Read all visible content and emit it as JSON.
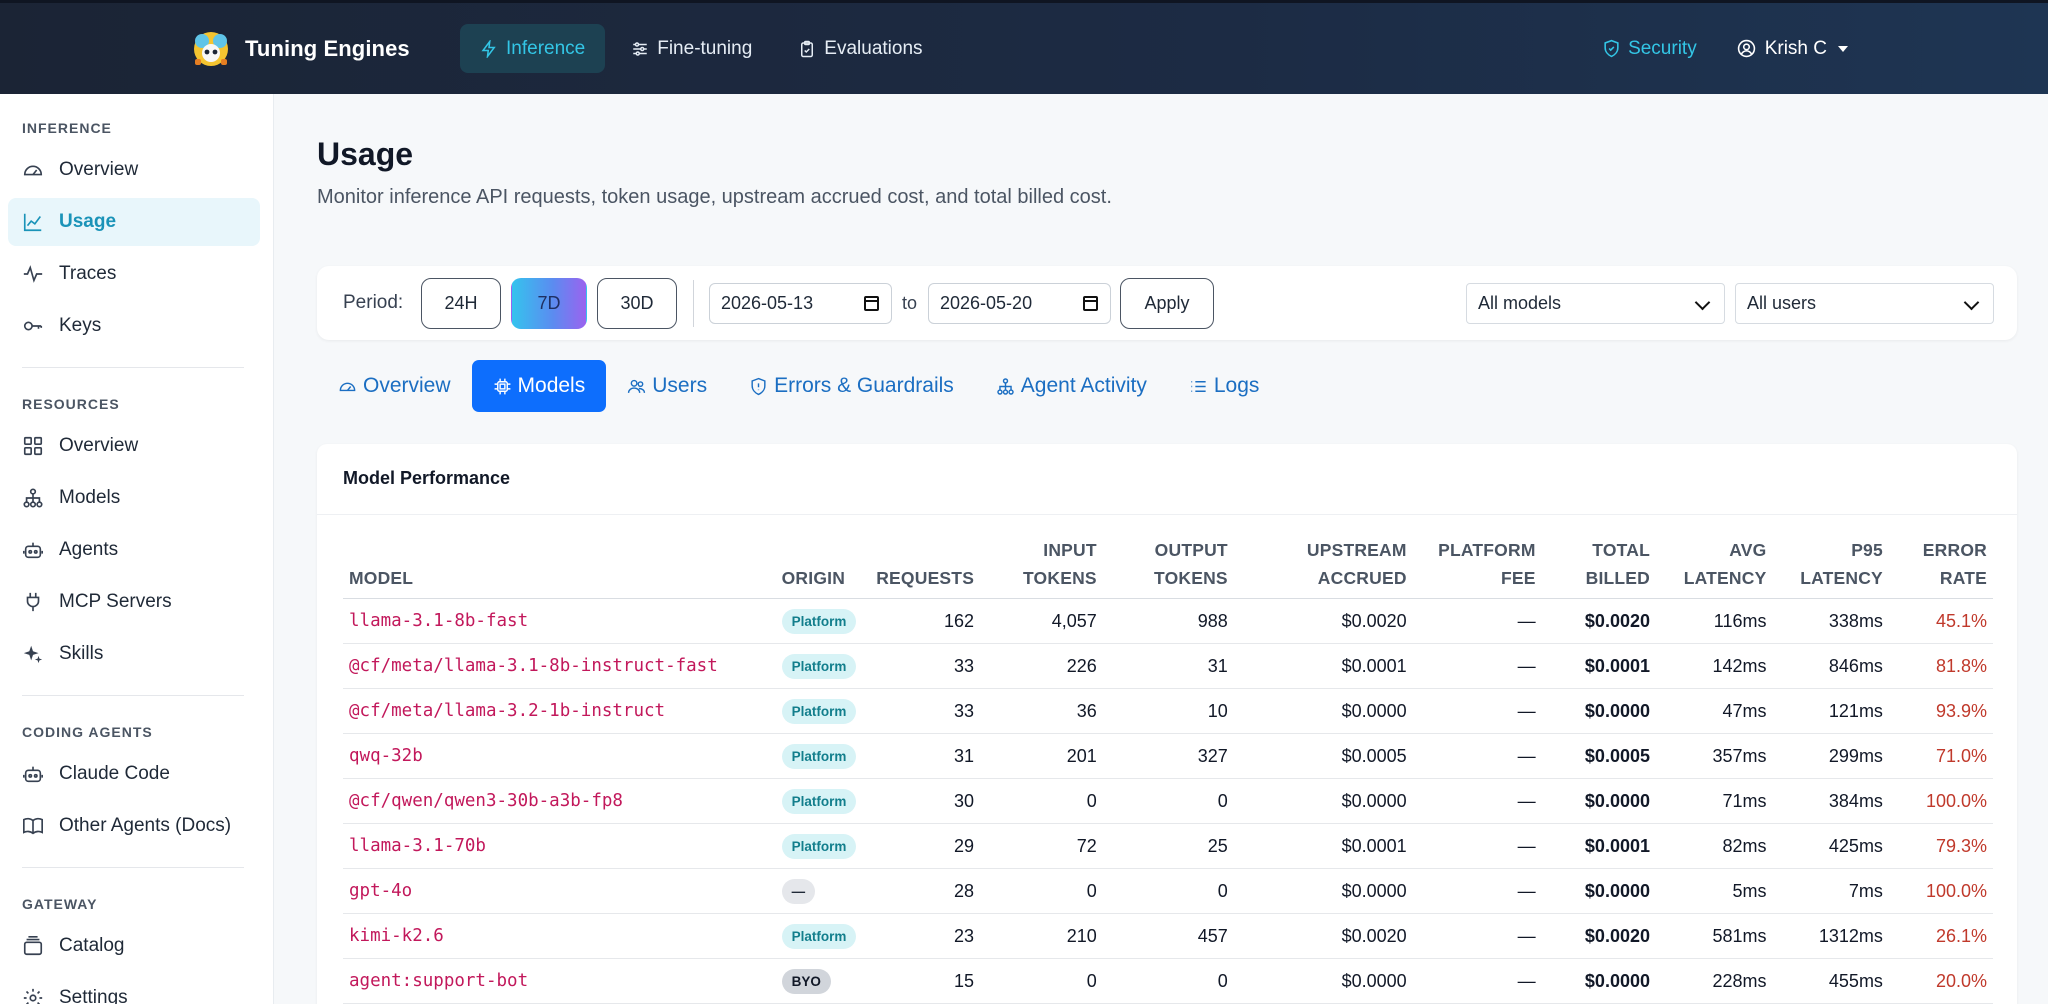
{
  "brand": {
    "name": "Tuning Engines"
  },
  "nav": [
    {
      "label": "Inference",
      "icon": "bolt-icon",
      "active": true
    },
    {
      "label": "Fine-tuning",
      "icon": "sliders-icon",
      "active": false
    },
    {
      "label": "Evaluations",
      "icon": "clipboard-icon",
      "active": false
    }
  ],
  "topright": {
    "security_label": "Security",
    "user_name": "Krish C"
  },
  "sidebar": {
    "sections": [
      {
        "title": "INFERENCE",
        "items": [
          {
            "label": "Overview",
            "icon": "gauge-icon"
          },
          {
            "label": "Usage",
            "icon": "line-chart-icon",
            "active": true
          },
          {
            "label": "Traces",
            "icon": "pulse-icon"
          },
          {
            "label": "Keys",
            "icon": "key-icon"
          }
        ]
      },
      {
        "title": "RESOURCES",
        "items": [
          {
            "label": "Overview",
            "icon": "grid-icon"
          },
          {
            "label": "Models",
            "icon": "hierarchy-icon"
          },
          {
            "label": "Agents",
            "icon": "robot-icon"
          },
          {
            "label": "MCP Servers",
            "icon": "plug-icon"
          },
          {
            "label": "Skills",
            "icon": "sparkles-icon"
          }
        ]
      },
      {
        "title": "CODING AGENTS",
        "items": [
          {
            "label": "Claude Code",
            "icon": "robot-icon"
          },
          {
            "label": "Other Agents (Docs)",
            "icon": "book-icon"
          }
        ]
      },
      {
        "title": "GATEWAY",
        "items": [
          {
            "label": "Catalog",
            "icon": "catalog-icon"
          },
          {
            "label": "Settings",
            "icon": "gear-icon"
          }
        ]
      }
    ]
  },
  "page": {
    "title": "Usage",
    "subtitle": "Monitor inference API requests, token usage, upstream accrued cost, and total billed cost."
  },
  "filters": {
    "period_label": "Period:",
    "periods": [
      "24H",
      "7D",
      "30D"
    ],
    "active_period": "7D",
    "date_from": "2026-05-13",
    "to_label": "to",
    "date_to": "2026-05-20",
    "apply_label": "Apply",
    "model_select": "All models",
    "user_select": "All users"
  },
  "tabs": [
    {
      "label": "Overview",
      "icon": "gauge-icon"
    },
    {
      "label": "Models",
      "icon": "chip-icon",
      "active": true
    },
    {
      "label": "Users",
      "icon": "users-icon"
    },
    {
      "label": "Errors & Guardrails",
      "icon": "shield-icon"
    },
    {
      "label": "Agent Activity",
      "icon": "hierarchy-icon"
    },
    {
      "label": "Logs",
      "icon": "list-icon"
    }
  ],
  "table": {
    "title": "Model Performance",
    "columns": [
      [
        "MODEL"
      ],
      [
        "ORIGIN"
      ],
      [
        "REQUESTS"
      ],
      [
        "INPUT",
        "TOKENS"
      ],
      [
        "OUTPUT",
        "TOKENS"
      ],
      [
        "UPSTREAM",
        "ACCRUED"
      ],
      [
        "PLATFORM",
        "FEE"
      ],
      [
        "TOTAL",
        "BILLED"
      ],
      [
        "AVG",
        "LATENCY"
      ],
      [
        "P95",
        "LATENCY"
      ],
      [
        "ERROR",
        "RATE"
      ]
    ],
    "rows": [
      {
        "model": "llama-3.1-8b-fast",
        "origin": "Platform",
        "requests": "162",
        "input": "4,057",
        "output": "988",
        "upstream": "$0.0020",
        "fee": "—",
        "total": "$0.0020",
        "avg": "116ms",
        "p95": "338ms",
        "err": "45.1%"
      },
      {
        "model": "@cf/meta/llama-3.1-8b-instruct-fast",
        "origin": "Platform",
        "requests": "33",
        "input": "226",
        "output": "31",
        "upstream": "$0.0001",
        "fee": "—",
        "total": "$0.0001",
        "avg": "142ms",
        "p95": "846ms",
        "err": "81.8%"
      },
      {
        "model": "@cf/meta/llama-3.2-1b-instruct",
        "origin": "Platform",
        "requests": "33",
        "input": "36",
        "output": "10",
        "upstream": "$0.0000",
        "fee": "—",
        "total": "$0.0000",
        "avg": "47ms",
        "p95": "121ms",
        "err": "93.9%"
      },
      {
        "model": "qwq-32b",
        "origin": "Platform",
        "requests": "31",
        "input": "201",
        "output": "327",
        "upstream": "$0.0005",
        "fee": "—",
        "total": "$0.0005",
        "avg": "357ms",
        "p95": "299ms",
        "err": "71.0%"
      },
      {
        "model": "@cf/qwen/qwen3-30b-a3b-fp8",
        "origin": "Platform",
        "requests": "30",
        "input": "0",
        "output": "0",
        "upstream": "$0.0000",
        "fee": "—",
        "total": "$0.0000",
        "avg": "71ms",
        "p95": "384ms",
        "err": "100.0%"
      },
      {
        "model": "llama-3.1-70b",
        "origin": "Platform",
        "requests": "29",
        "input": "72",
        "output": "25",
        "upstream": "$0.0001",
        "fee": "—",
        "total": "$0.0001",
        "avg": "82ms",
        "p95": "425ms",
        "err": "79.3%"
      },
      {
        "model": "gpt-4o",
        "origin": "—",
        "requests": "28",
        "input": "0",
        "output": "0",
        "upstream": "$0.0000",
        "fee": "—",
        "total": "$0.0000",
        "avg": "5ms",
        "p95": "7ms",
        "err": "100.0%"
      },
      {
        "model": "kimi-k2.6",
        "origin": "Platform",
        "requests": "23",
        "input": "210",
        "output": "457",
        "upstream": "$0.0020",
        "fee": "—",
        "total": "$0.0020",
        "avg": "581ms",
        "p95": "1312ms",
        "err": "26.1%"
      },
      {
        "model": "agent:support-bot",
        "origin": "BYO",
        "requests": "15",
        "input": "0",
        "output": "0",
        "upstream": "$0.0000",
        "fee": "—",
        "total": "$0.0000",
        "avg": "228ms",
        "p95": "455ms",
        "err": "20.0%"
      }
    ]
  },
  "colors": {
    "accent": "#33c6e6",
    "tab_active": "#0d6efd",
    "model_text": "#c2185b",
    "error_text": "#c0392b"
  }
}
